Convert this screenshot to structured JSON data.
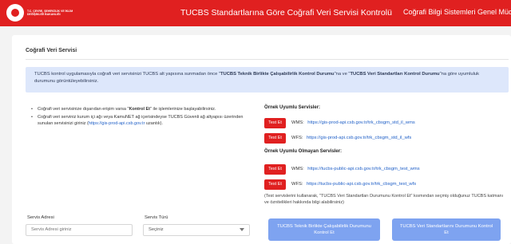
{
  "header": {
    "logo_text": "T.C. ÇEVRE, ŞEHİRCİLİK VE İKLİM DEĞİŞİKLİĞİ BAKANLIĞI",
    "title": "TUCBS Standartlarına Göre Coğrafi Veri Servisi Kontrolü",
    "right_title": "Coğrafi Bilgi Sistemleri Genel Müdürlü"
  },
  "panel": {
    "title": "Coğrafi Veri Servisi",
    "info": {
      "part1": "TUCBS kontrol uygulamasıyla coğrafi veri servisinizi TUCBS alt yapısına sunmadan önce \"",
      "bold1": "TUCBS Teknik Birlikte Çalışabilirlik Kontrol Durumu",
      "part2": "\"na ve \"",
      "bold2": "TUCBS Veri Standartları Kontrol Durumu",
      "part3": "\"na göre uyumluluk durumunu görüntüleyebilirsiniz."
    },
    "bullets": {
      "b1_pre": "Coğrafi veri servisinize dışarıdan erişim varsa \"",
      "b1_bold": "Kontrol Et",
      "b1_post": "\" ile işlemlerinize başlayabilirsiniz.",
      "b2_pre": "Coğrafi veri serviniz kurum içi ağı veya KamuNET ağ içerisindeyse TUCBS Güvenli ağ altyapısı üzerinden sunulan servisinizi giriniz (",
      "b2_link": "https://gis-prod-api.csb.gov.tr",
      "b2_post": " uzantılı)."
    },
    "compliant": {
      "title": "Örnek Uyumlu Servisler:",
      "items": [
        {
          "button": "Test Et",
          "type": "WMS:",
          "url": "https://gis-prod-api.csb.gov.tr/trk_cbsgm_std_il_wms"
        },
        {
          "button": "Test Et",
          "type": "WFS:",
          "url": "https://gis-prod-api.csb.gov.tr/trk_cbsgm_std_il_wfs"
        }
      ]
    },
    "noncompliant": {
      "title": "Örnek Uyumlu Olmayan Servisler:",
      "items": [
        {
          "button": "Test Et",
          "type": "WMS:",
          "url": "https://tucbs-public-api.csb.gov.tr/trk_cbsgm_test_wms"
        },
        {
          "button": "Test Et",
          "type": "WFS:",
          "url": "https://tucbs-public-api.csb.gov.tr/trk_cbsgm_test_wfs"
        }
      ]
    },
    "note": "(Test servislerini kullanarak, \"TUCBS Veri Standartları Durumunu Kontrol Et\" kısmından seçmiş olduğunuz TUCBS katmanı ve öznitelikleri hakkında bilgi alabilirsiniz)",
    "form": {
      "address_label": "Servis Adresi",
      "address_placeholder": "Servis Adresi giriniz",
      "type_label": "Servis Türü",
      "type_value": "Seçiniz"
    },
    "actions": {
      "technical": "TUCBS Teknik Birlikte Çalışabilirlik Durumunu Kontrol Et",
      "standards": "TUCBS Veri Standartlarını Durumunu Kontrol Et"
    }
  },
  "colors": {
    "brand_red": "#e02020",
    "info_bg": "#dde7fb",
    "action_blue": "#7ea3f0",
    "link_blue": "#1f5fc7"
  }
}
